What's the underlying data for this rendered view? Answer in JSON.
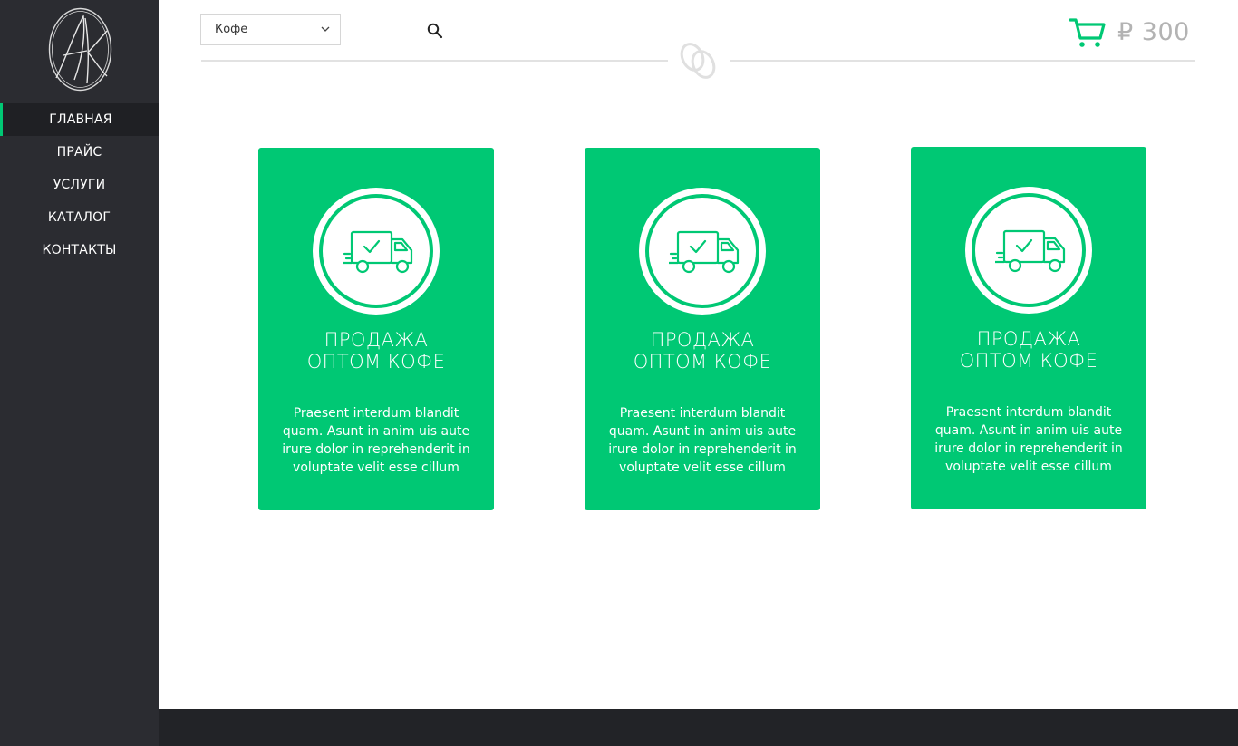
{
  "sidebar": {
    "logo_icon": "ak-monogram-logo",
    "items": [
      {
        "label": "ГЛАВНАЯ",
        "active": true
      },
      {
        "label": "ПРАЙС",
        "active": false
      },
      {
        "label": "УСЛУГИ",
        "active": false
      },
      {
        "label": "КАТАЛОГ",
        "active": false
      },
      {
        "label": "КОНТАКТЫ",
        "active": false
      }
    ]
  },
  "header": {
    "category_select": {
      "value": "Кофе",
      "icon": "chevron-down-icon"
    },
    "search_icon": "search-icon",
    "divider_icon": "coffee-beans-icon",
    "cart": {
      "icon": "cart-icon",
      "price": "₽ 300"
    }
  },
  "cards": [
    {
      "icon": "delivery-truck-icon",
      "title": "ПРОДАЖА\nОПТОМ КОФЕ",
      "description": "Praesent interdum blandit quam. Asunt in anim uis aute irure dolor in reprehenderit in voluptate velit esse cillum"
    },
    {
      "icon": "delivery-truck-icon",
      "title": "ПРОДАЖА\nОПТОМ КОФЕ",
      "description": "Praesent interdum blandit quam. Asunt in anim uis aute irure dolor in reprehenderit in voluptate velit esse cillum"
    },
    {
      "icon": "delivery-truck-icon",
      "title": "ПРОДАЖА\nОПТОМ КОФЕ",
      "description": "Praesent interdum blandit quam. Asunt in anim uis aute irure dolor in reprehenderit in voluptate velit esse cillum"
    }
  ],
  "colors": {
    "accent": "#00c874",
    "sidebar_bg": "#2b2c31",
    "footer_bg": "#222327",
    "price_text": "#b3b3b3"
  }
}
